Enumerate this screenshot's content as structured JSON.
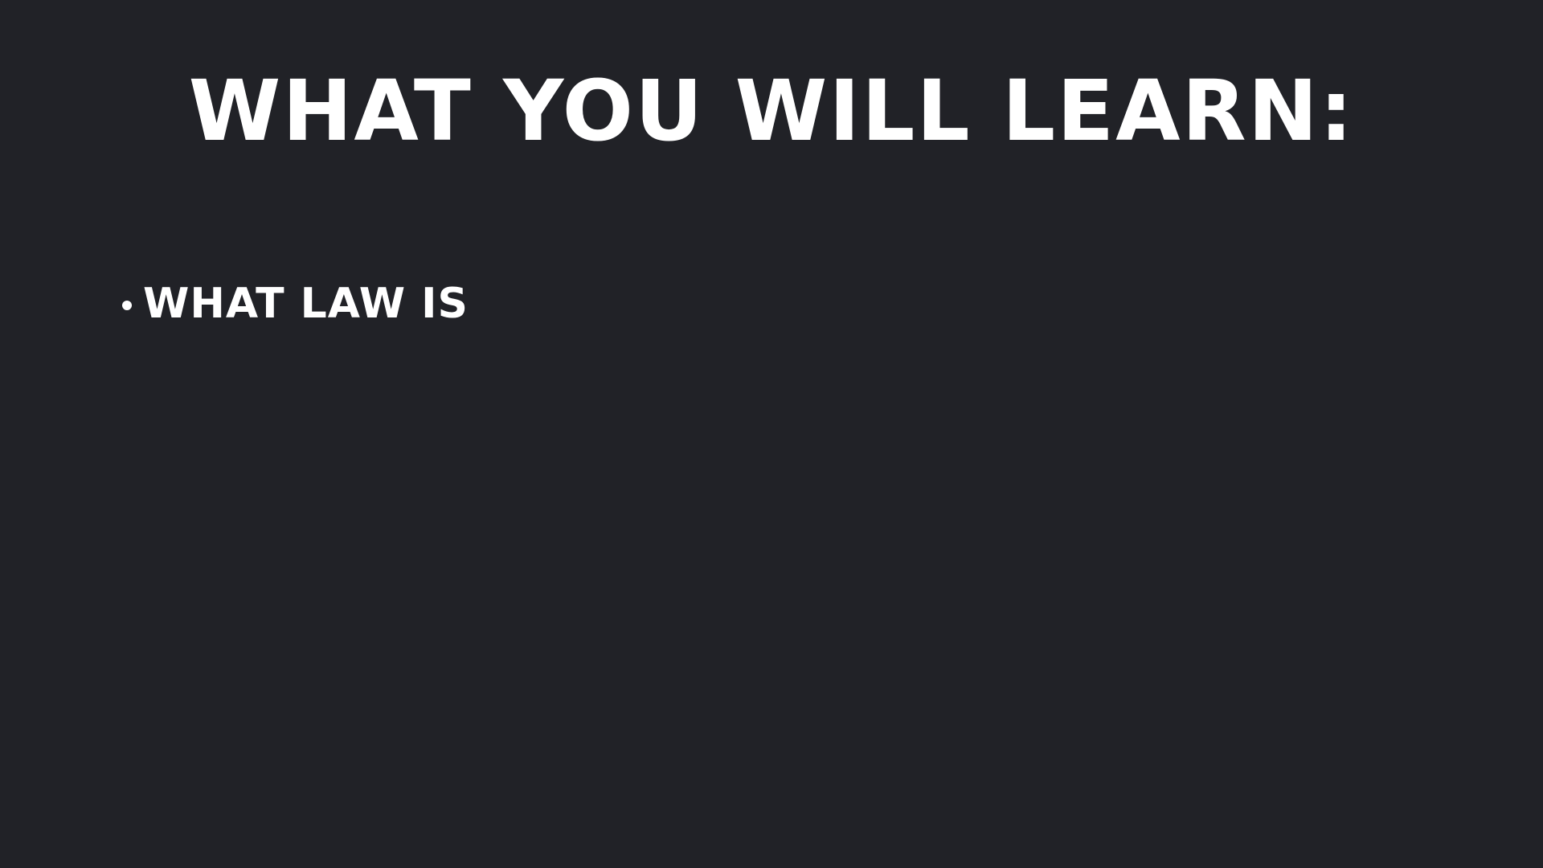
{
  "slide": {
    "title": "What you will learn:",
    "bullets": [
      {
        "text": "What law is"
      }
    ]
  },
  "colors": {
    "background": "#212227",
    "text": "#ffffff"
  }
}
